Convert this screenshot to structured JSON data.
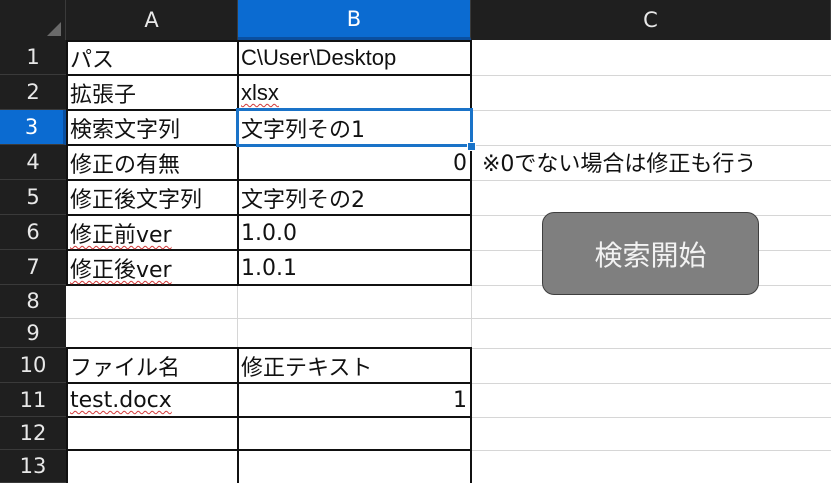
{
  "columns": [
    "A",
    "B",
    "C"
  ],
  "rows": [
    "1",
    "2",
    "3",
    "4",
    "5",
    "6",
    "7",
    "8",
    "9",
    "10",
    "11",
    "12",
    "13"
  ],
  "selected_column": "B",
  "selected_row": "3",
  "cells": {
    "A1": "パス",
    "B1": "C\\User\\Desktop",
    "A2": "拡張子",
    "B2": "xlsx",
    "A3": "検索文字列",
    "B3": "文字列その1",
    "A4": "修正の有無",
    "B4": "0",
    "A5": "修正後文字列",
    "B5": "文字列その2",
    "A6": "修正前ver",
    "B6": "1.0.0",
    "A7": "修正後ver",
    "B7": "1.0.1",
    "A10": "ファイル名",
    "B10": "修正テキスト",
    "A11": "test.docx",
    "B11": "1"
  },
  "note": "※0でない場合は修正も行う",
  "search_button_label": "検索開始"
}
